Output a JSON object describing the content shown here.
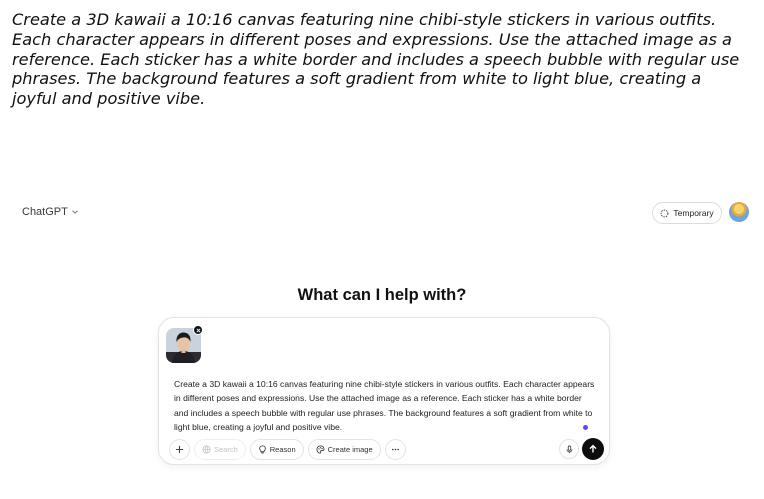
{
  "caption": "Create a 3D kawaii a 10:16 canvas featuring nine chibi-style stickers in various outfits. Each character appears in different poses and expressions. Use the attached image as a reference. Each sticker has a white border and includes a speech bubble with regular use phrases. The background features a soft gradient from white to light blue, creating a joyful and positive vibe.",
  "header": {
    "model_label": "ChatGPT",
    "model_icon": "chevron-down-icon",
    "temporary_label": "Temporary",
    "temporary_icon": "dashed-chat-icon"
  },
  "main": {
    "heading": "What can I help with?"
  },
  "composer": {
    "prompt_text": "Create a 3D kawaii a 10:16 canvas featuring  nine chibi-style stickers in various outfits. Each character appears in different poses and expressions. Use the attached image as a reference. Each sticker has a white border and includes a speech bubble with regular use phrases. The background features a soft gradient from white to light blue, creating a joyful and positive vibe.",
    "tools": {
      "plus_icon": "plus-icon",
      "search_label": "Search",
      "reason_label": "Reason",
      "create_image_label": "Create image",
      "more_icon": "ellipsis-icon"
    },
    "mic_icon": "mic-icon",
    "send_icon": "arrow-up-icon"
  },
  "colors": {
    "accent_dot": "#5b4bf2",
    "send_button": "#0d0d0d"
  }
}
